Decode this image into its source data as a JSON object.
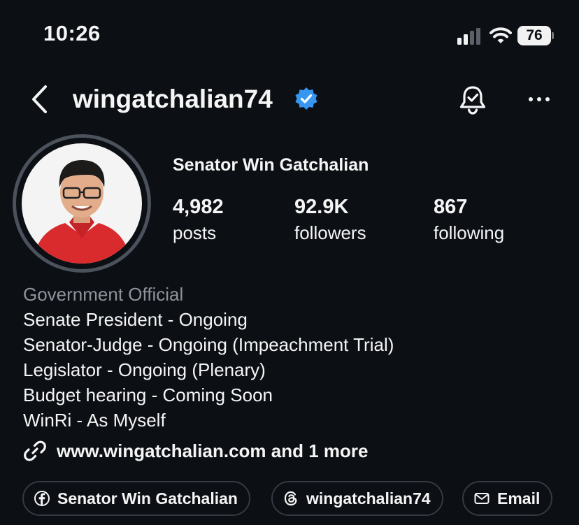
{
  "status_bar": {
    "time": "10:26",
    "battery_level": "76",
    "icons": [
      "cellular-signal-icon",
      "wifi-icon",
      "battery-icon"
    ]
  },
  "header": {
    "username": "wingatchalian74",
    "icons": [
      "back-chevron-icon",
      "verified-badge-icon",
      "notification-bell-icon",
      "more-options-icon"
    ],
    "accent_color": "#3797f0"
  },
  "profile": {
    "display_name": "Senator Win Gatchalian",
    "stats": [
      {
        "value": "4,982",
        "label": "posts"
      },
      {
        "value": "92.9K",
        "label": "followers"
      },
      {
        "value": "867",
        "label": "following"
      }
    ]
  },
  "bio": {
    "category": "Government Official",
    "lines": [
      "Senate President - Ongoing",
      "Senator-Judge - Ongoing (Impeachment Trial)",
      "Legislator - Ongoing (Plenary)",
      "Budget hearing - Coming Soon",
      "WinRi - As Myself"
    ]
  },
  "link": {
    "text": "www.wingatchalian.com and 1 more",
    "icon": "link-icon"
  },
  "chips": [
    {
      "label": "Senator Win Gatchalian",
      "icon": "facebook-icon"
    },
    {
      "label": "wingatchalian74",
      "icon": "threads-icon"
    },
    {
      "label": "Email",
      "icon": "mail-icon"
    }
  ]
}
